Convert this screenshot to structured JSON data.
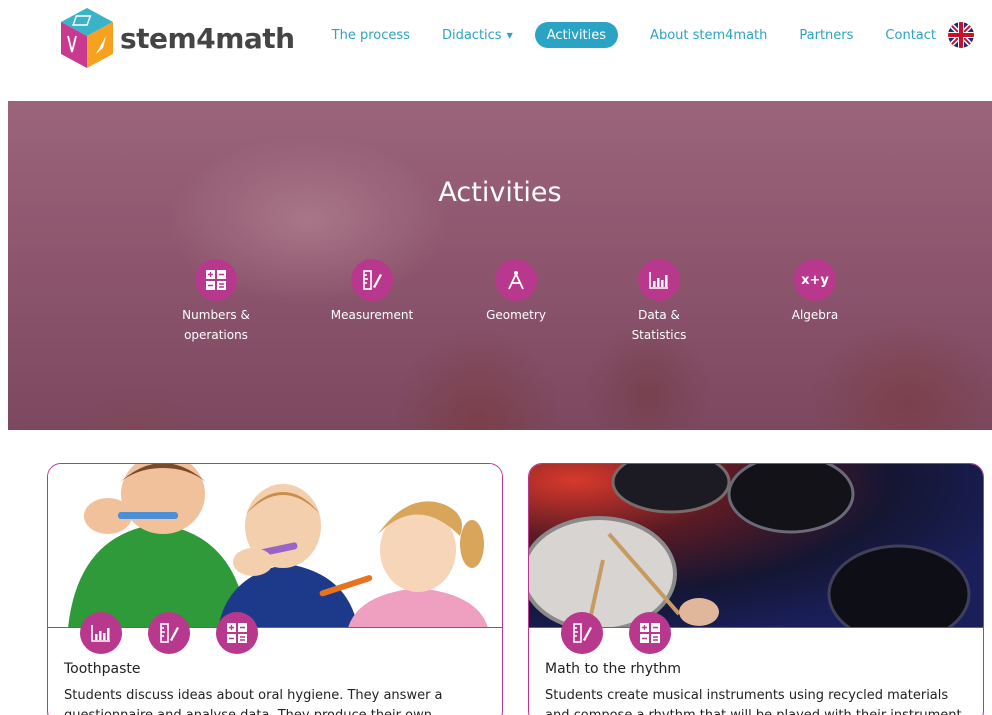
{
  "brand": {
    "name": "stem4math",
    "accent": "#b8388d",
    "link_color": "#2ba3c4"
  },
  "nav": {
    "items": [
      {
        "label": "The process",
        "active": false,
        "dropdown": false
      },
      {
        "label": "Didactics",
        "active": false,
        "dropdown": true
      },
      {
        "label": "Activities",
        "active": true,
        "dropdown": false
      },
      {
        "label": "About stem4math",
        "active": false,
        "dropdown": false
      },
      {
        "label": "Partners",
        "active": false,
        "dropdown": false
      },
      {
        "label": "Contact",
        "active": false,
        "dropdown": false
      }
    ],
    "language_icon": "uk-flag-icon"
  },
  "hero": {
    "title": "Activities",
    "categories": [
      {
        "label": "Numbers &\noperations",
        "icon": "calculator-icon"
      },
      {
        "label": "Measurement",
        "icon": "ruler-pencil-icon"
      },
      {
        "label": "Geometry",
        "icon": "compass-icon"
      },
      {
        "label": "Data &\nStatistics",
        "icon": "bar-chart-icon"
      },
      {
        "label": "Algebra",
        "icon": "x-plus-y-icon",
        "glyph": "x+y"
      }
    ]
  },
  "cards": [
    {
      "title": "Toothpaste",
      "description": "Students discuss ideas about oral hygiene. They answer a questionnaire and analyse data. They produce their own toothpaste.",
      "icons": [
        "bar-chart-icon",
        "ruler-pencil-icon",
        "calculator-icon"
      ]
    },
    {
      "title": "Math to the rhythm",
      "description": "Students create musical instruments using recycled materials and compose a rhythm that will be played with their instrument.",
      "icons": [
        "ruler-pencil-icon",
        "calculator-icon"
      ]
    }
  ]
}
